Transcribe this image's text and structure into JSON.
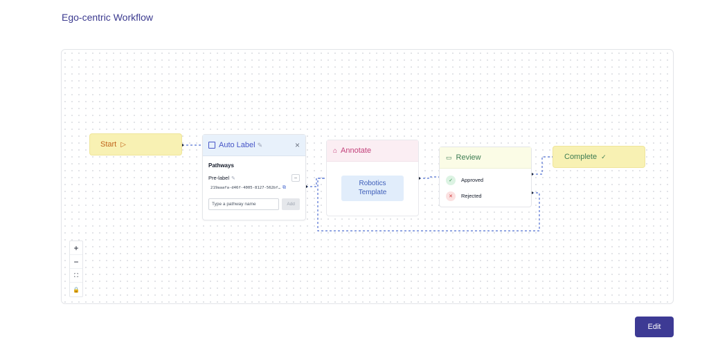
{
  "page": {
    "title": "Ego-centric Workflow"
  },
  "nodes": {
    "start": {
      "label": "Start",
      "icon": "play-icon"
    },
    "auto_label": {
      "title": "Auto Label",
      "icon": "frame-icon",
      "section_title": "Pathways",
      "pathway_name": "Pre-label",
      "pathway_id": "219aaafa-d46f-4005-8127-562bf…",
      "input_placeholder": "Type a pathway name",
      "add_label": "Add",
      "close_label": "×",
      "remove_label": "−"
    },
    "annotate": {
      "title": "Annotate",
      "icon": "tag-icon",
      "template_line1": "Robotics",
      "template_line2": "Template"
    },
    "review": {
      "title": "Review",
      "icon": "monitor-icon",
      "outcomes": [
        {
          "label": "Approved",
          "icon": "check-icon",
          "color": "#2f8a4a"
        },
        {
          "label": "Rejected",
          "icon": "x-icon",
          "color": "#d23c3c"
        }
      ]
    },
    "complete": {
      "label": "Complete",
      "icon": "check-icon"
    }
  },
  "controls": {
    "zoom_in": "+",
    "zoom_out": "−",
    "fit": "⛶",
    "lock": "🔒"
  },
  "footer": {
    "edit_label": "Edit"
  },
  "colors": {
    "accent": "#3d3a94",
    "edge": "#4f6fd1",
    "start_fill": "#f8f1b3"
  }
}
